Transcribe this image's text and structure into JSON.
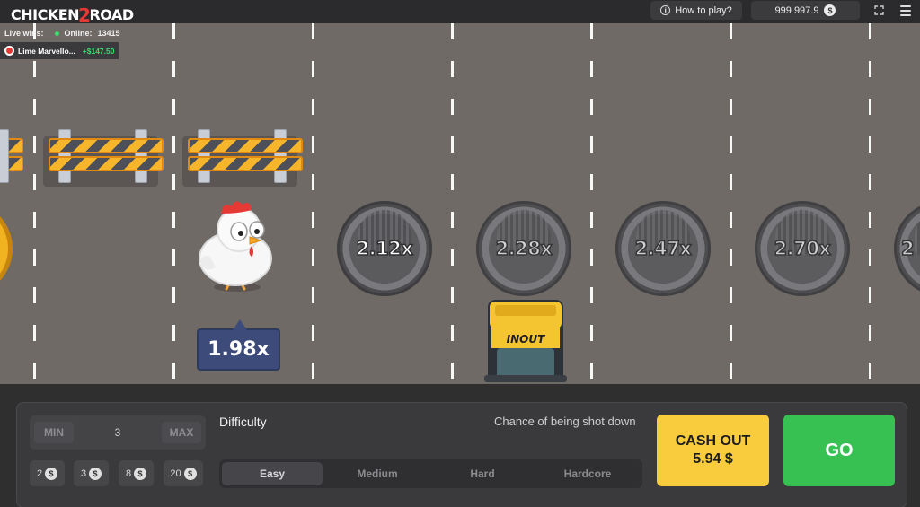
{
  "header": {
    "logo": {
      "part1": "CHICKEN",
      "part2": "2",
      "part3": "ROAD"
    },
    "how_to_play": "How to play?",
    "balance": "999 997.9",
    "currency_symbol": "$",
    "info_icon_glyph": "i",
    "fullscreen_glyph": "⛶"
  },
  "live": {
    "label": "Live wins:",
    "online_label": "Online:",
    "online_count": "13415",
    "recent_winner": {
      "name": "Lime Marvello...",
      "amount": "+$147.50"
    }
  },
  "road": {
    "multipliers": [
      "2.12x",
      "2.28x",
      "2.47x",
      "2.70x",
      "2"
    ],
    "chicken_multiplier": "1.98x",
    "truck_brand": "INOUT"
  },
  "controls": {
    "min_label": "MIN",
    "max_label": "MAX",
    "bet_value": "3",
    "quick_bets": [
      "2",
      "3",
      "8",
      "20"
    ],
    "difficulty_label": "Difficulty",
    "chance_label": "Chance of being shot down",
    "difficulties": [
      "Easy",
      "Medium",
      "Hard",
      "Hardcore"
    ],
    "selected_difficulty": "Easy",
    "cashout_label": "CASH OUT",
    "cashout_amount": "5.94 $",
    "go_label": "GO"
  },
  "colors": {
    "road": "#706a66",
    "cashout": "#f8cc3c",
    "go": "#37c152",
    "multiplier_tag": "#3c4b79",
    "win_amount": "#3ddc6c"
  }
}
